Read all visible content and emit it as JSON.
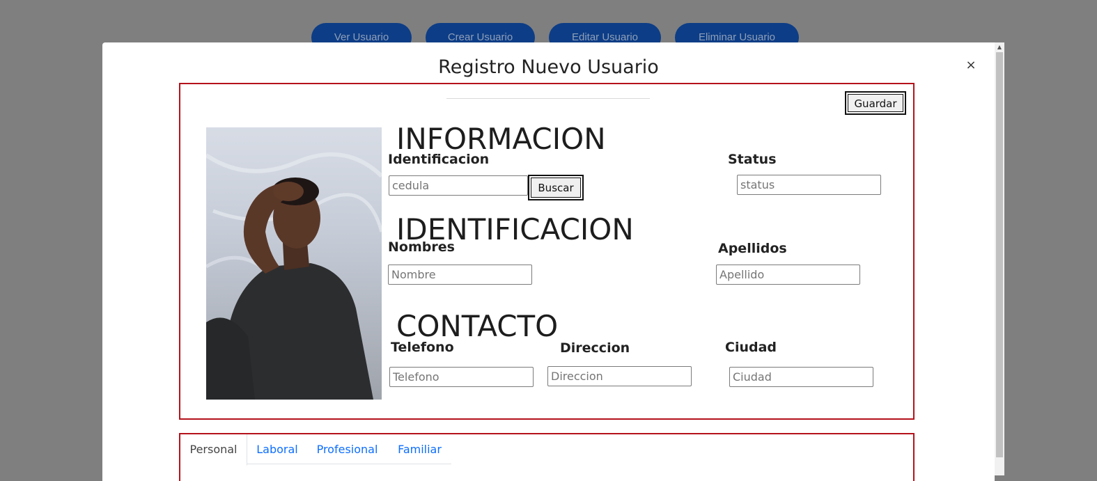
{
  "nav": {
    "ver_usuario": "Ver Usuario",
    "crear_usuario": "Crear Usuario",
    "editar_usuario": "Editar Usuario",
    "eliminar_usuario": "Eliminar Usuario"
  },
  "modal": {
    "title": "Registro Nuevo Usuario",
    "close_label": "×",
    "save_label": "Guardar"
  },
  "sections": {
    "informacion": "INFORMACION",
    "identificacion": "IDENTIFICACION",
    "contacto": "CONTACTO"
  },
  "fields": {
    "identificacion": {
      "label": "Identificacion",
      "placeholder": "cedula",
      "button": "Buscar"
    },
    "status": {
      "label": "Status",
      "placeholder": "status"
    },
    "nombres": {
      "label": "Nombres",
      "placeholder": "Nombre"
    },
    "apellidos": {
      "label": "Apellidos",
      "placeholder": "Apellido"
    },
    "telefono": {
      "label": "Telefono",
      "placeholder": "Telefono"
    },
    "direccion": {
      "label": "Direccion",
      "placeholder": "Direccion"
    },
    "ciudad": {
      "label": "Ciudad",
      "placeholder": "Ciudad"
    }
  },
  "tabs": [
    {
      "label": "Personal"
    },
    {
      "label": "Laboral"
    },
    {
      "label": "Profesional"
    },
    {
      "label": "Familiar"
    }
  ],
  "colors": {
    "accent_red": "#b5121b",
    "nav_blue": "#0d3d86",
    "link_blue": "#0d6efd",
    "overlay": "#7f7f7f"
  }
}
